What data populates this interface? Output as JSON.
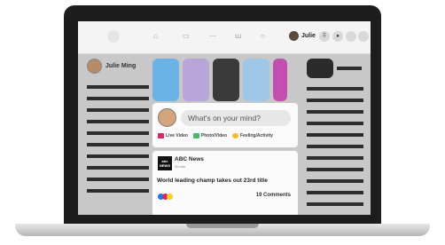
{
  "header": {
    "user_name": "Julie"
  },
  "sidebar": {
    "profile_name": "Julie Ming"
  },
  "composer": {
    "placeholder": "What's on your mind?",
    "actions": [
      {
        "label": "Live Video",
        "icon": "live-video-icon",
        "color": "#e0245e"
      },
      {
        "label": "Photo/Video",
        "icon": "photo-video-icon",
        "color": "#45bd62"
      },
      {
        "label": "Feeling/Activity",
        "icon": "feeling-activity-icon",
        "color": "#f7b928"
      }
    ]
  },
  "post": {
    "logo_text": "abc NEWS",
    "source": "ABC News",
    "time": "20 min",
    "headline": "World leading champ takes out 23rd title",
    "comments": "19 Comments",
    "reaction_colors": [
      "#1877f2",
      "#e0245e",
      "#f7d020"
    ]
  },
  "stories": [
    {
      "name": "story-dog-blue",
      "color": "#6ab3e6"
    },
    {
      "name": "story-woman-purple",
      "color": "#b8a6d9"
    },
    {
      "name": "story-dog-dark",
      "color": "#3a3a3a"
    },
    {
      "name": "story-tree-landscape",
      "color": "#9fc7e8"
    },
    {
      "name": "story-flowers-pink",
      "color": "#c24fb0"
    }
  ]
}
